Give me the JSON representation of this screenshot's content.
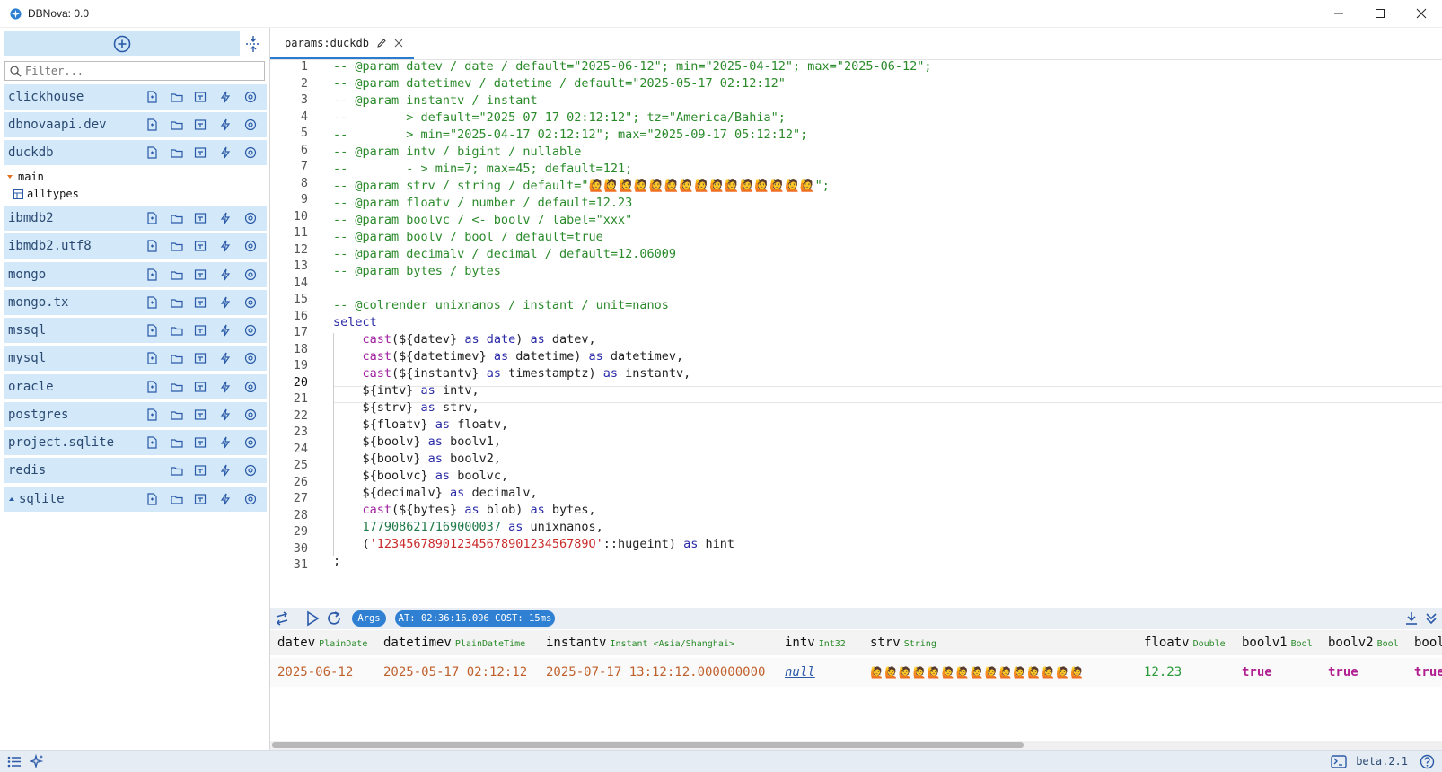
{
  "window": {
    "title": "DBNova: 0.0"
  },
  "sidebar": {
    "filter_placeholder": "Filter...",
    "connections": [
      {
        "name": "clickhouse"
      },
      {
        "name": "dbnovaapi.dev"
      },
      {
        "name": "duckdb"
      },
      {
        "name": "ibmdb2"
      },
      {
        "name": "ibmdb2.utf8"
      },
      {
        "name": "mongo"
      },
      {
        "name": "mongo.tx"
      },
      {
        "name": "mssql"
      },
      {
        "name": "mysql"
      },
      {
        "name": "oracle"
      },
      {
        "name": "postgres"
      },
      {
        "name": "project.sqlite"
      },
      {
        "name": "redis"
      },
      {
        "name": "sqlite"
      }
    ],
    "tree": {
      "schema": "main",
      "table": "alltypes"
    }
  },
  "editor": {
    "tab_label": "params:duckdb",
    "active_line": 20,
    "line_numbers": [
      "1",
      "2",
      "3",
      "4",
      "5",
      "6",
      "7",
      "8",
      "9",
      "10",
      "11",
      "12",
      "13",
      "14",
      "15",
      "16",
      "17",
      "18",
      "19",
      "20",
      "21",
      "22",
      "23",
      "24",
      "25",
      "26",
      "27",
      "28",
      "29",
      "30",
      "31"
    ]
  },
  "results": {
    "args_label": "Args",
    "status": "AT: 02:36:16.096 COST: 15ms",
    "columns": [
      {
        "name": "datev",
        "type": "PlainDate"
      },
      {
        "name": "datetimev",
        "type": "PlainDateTime"
      },
      {
        "name": "instantv",
        "type": "Instant <Asia/Shanghai>"
      },
      {
        "name": "intv",
        "type": "Int32"
      },
      {
        "name": "strv",
        "type": "String"
      },
      {
        "name": "floatv",
        "type": "Double"
      },
      {
        "name": "boolv1",
        "type": "Bool"
      },
      {
        "name": "boolv2",
        "type": "Bool"
      },
      {
        "name": "bool",
        "type": ""
      }
    ],
    "row": {
      "datev": "2025-06-12",
      "datetimev": "2025-05-17 02:12:12",
      "instantv": "2025-07-17 13:12:12.000000000",
      "intv": "null",
      "strv": "🙋🙋🙋🙋🙋🙋🙋🙋🙋🙋🙋🙋🙋🙋🙋",
      "floatv": "12.23",
      "boolv1": "true",
      "boolv2": "true",
      "boolvc": "true"
    }
  },
  "statusbar": {
    "version": "beta.2.1"
  },
  "colors": {
    "accent": "#2f7fd2",
    "sidebar_item_bg": "#d3e8f8",
    "comment": "#2a8a2a"
  }
}
